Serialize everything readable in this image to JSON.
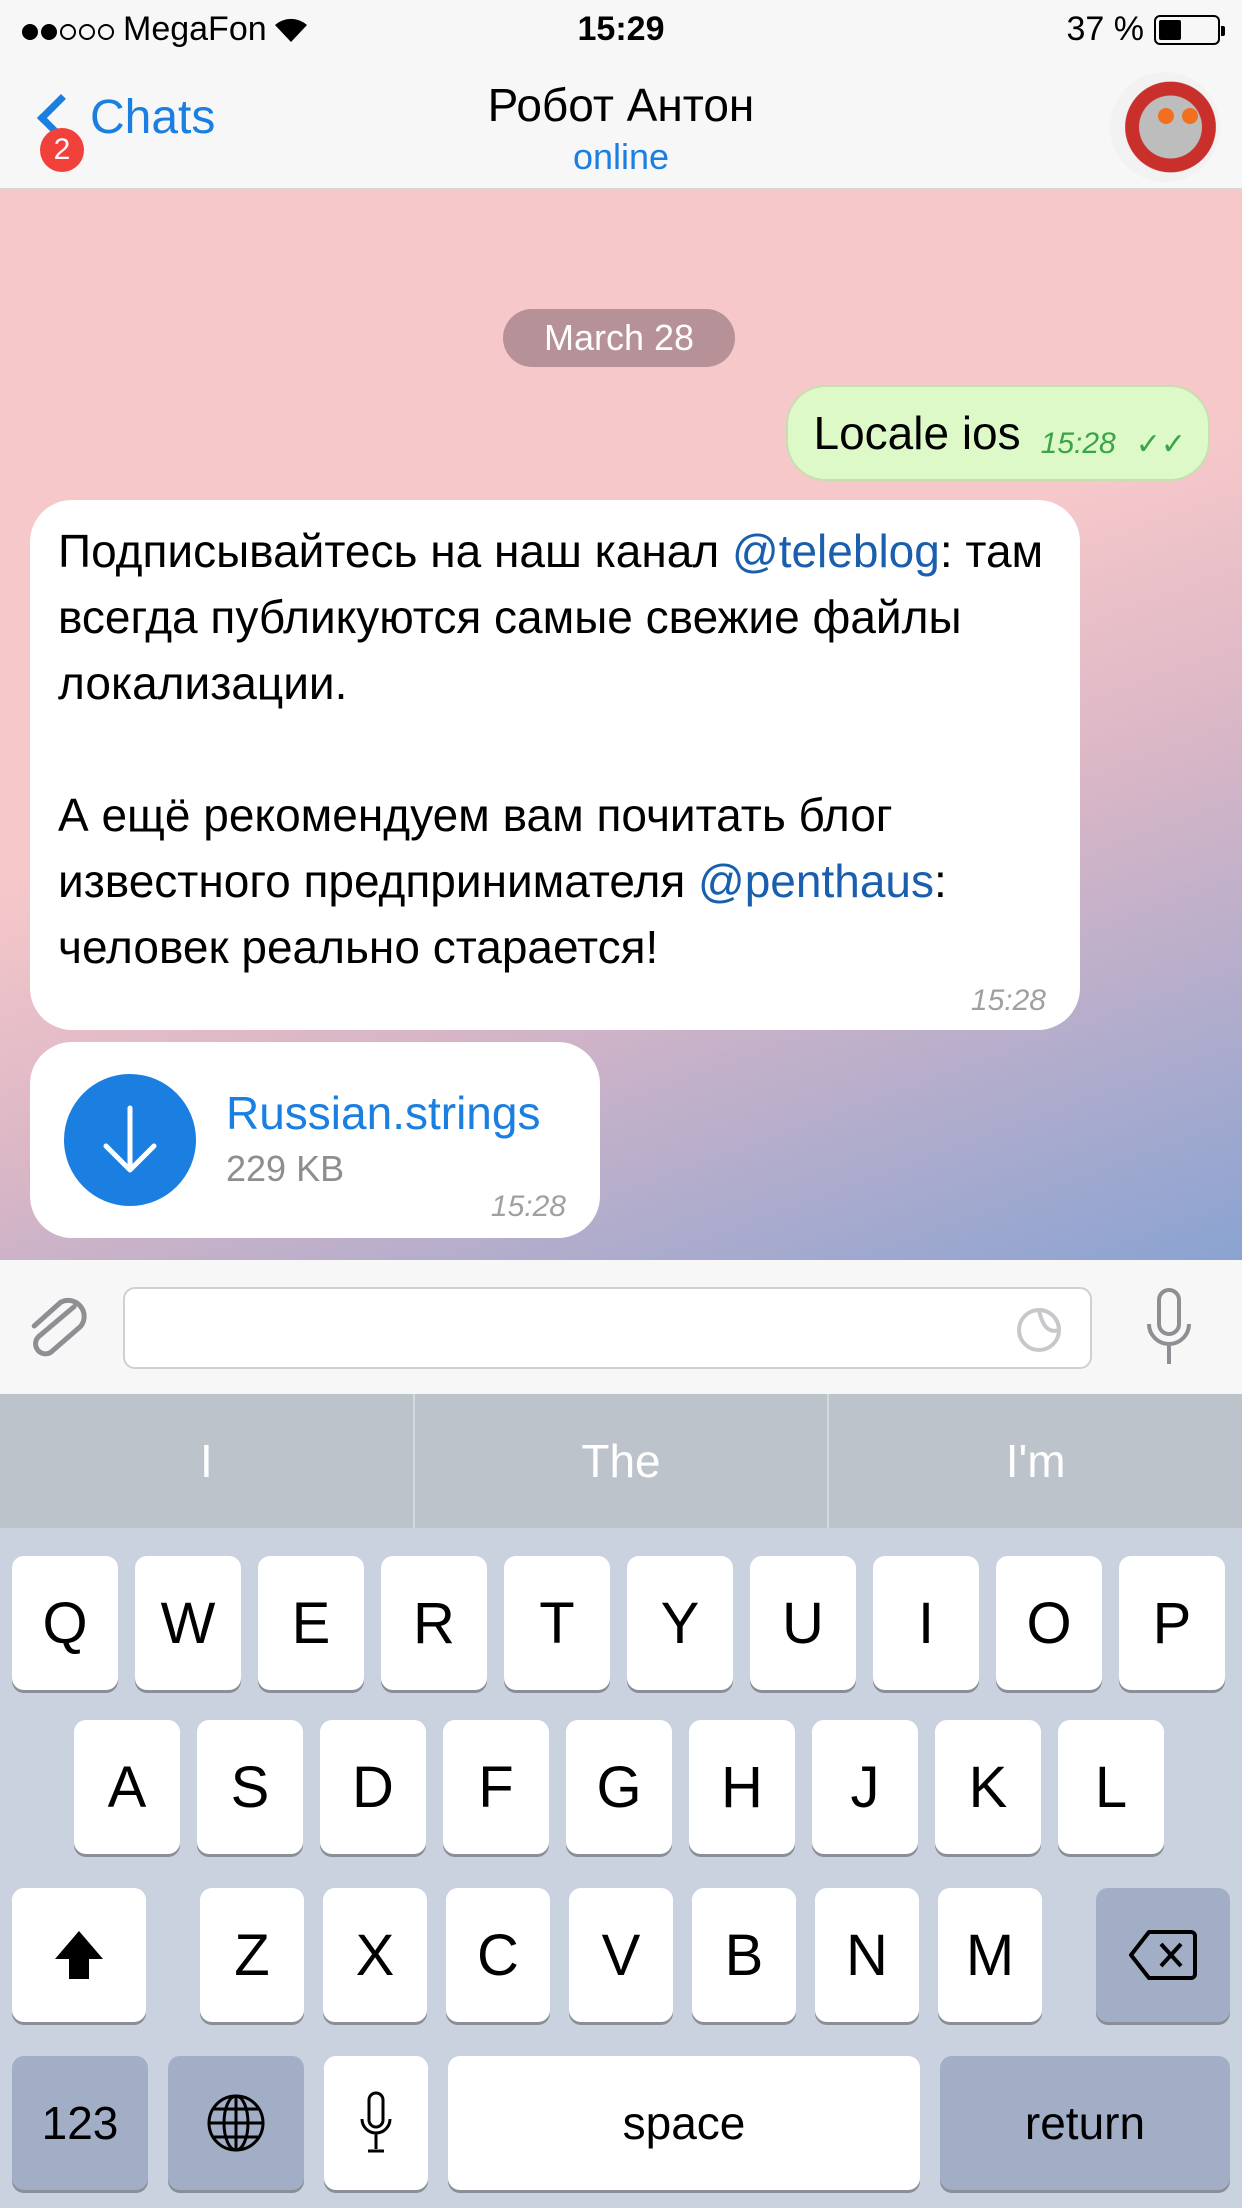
{
  "status_bar": {
    "signal_filled": 2,
    "signal_total": 5,
    "carrier": "MegaFon",
    "time": "15:29",
    "battery_text": "37 %",
    "battery_level": 0.37
  },
  "nav": {
    "back_label": "Chats",
    "unread_badge": "2",
    "title": "Робот Антон",
    "subtitle": "online"
  },
  "chat": {
    "date_separator": "March 28",
    "messages": [
      {
        "direction": "outgoing",
        "text": "Locale ios",
        "time": "15:28",
        "status": "read"
      },
      {
        "direction": "incoming",
        "paragraphs": [
          {
            "parts": [
              {
                "text": "Подписывайтесь на наш канал "
              },
              {
                "text": "@teleblog",
                "link": true
              },
              {
                "text": ": там всегда публикуются самые свежие файлы локализации."
              }
            ]
          },
          {
            "parts": [
              {
                "text": "А ещё рекомендуем вам почитать блог известного предпринимателя "
              },
              {
                "text": "@penthaus",
                "link": true
              },
              {
                "text": ": человек реально старается!"
              }
            ]
          }
        ],
        "time": "15:28"
      },
      {
        "direction": "incoming",
        "type": "file",
        "file_name": "Russian.strings",
        "file_size": "229 KB",
        "time": "15:28"
      }
    ]
  },
  "input": {
    "placeholder": "",
    "value": ""
  },
  "suggestions": [
    "I",
    "The",
    "I'm"
  ],
  "keyboard": {
    "row1": [
      "Q",
      "W",
      "E",
      "R",
      "T",
      "Y",
      "U",
      "I",
      "O",
      "P"
    ],
    "row2": [
      "A",
      "S",
      "D",
      "F",
      "G",
      "H",
      "J",
      "K",
      "L"
    ],
    "row3": [
      "Z",
      "X",
      "C",
      "V",
      "B",
      "N",
      "M"
    ],
    "numbers": "123",
    "space": "space",
    "return": "return"
  },
  "colors": {
    "accent": "#1a7fe0",
    "outgoing_bubble": "#def9c8",
    "badge": "#f2403b",
    "link": "#1a5fae"
  }
}
